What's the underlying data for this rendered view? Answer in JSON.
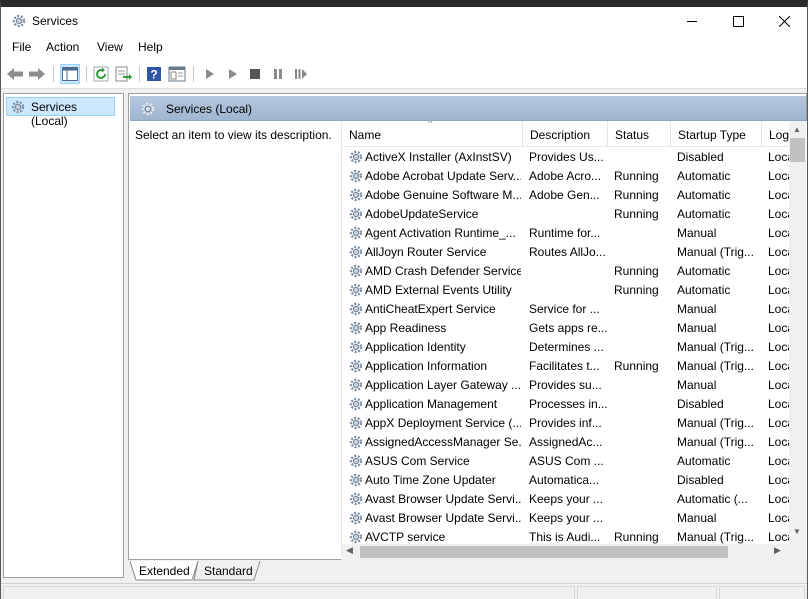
{
  "window": {
    "title": "Services",
    "icon": "gear-icon"
  },
  "menu": [
    "File",
    "Action",
    "View",
    "Help"
  ],
  "toolbar": {
    "buttons": [
      "back-arrow-icon",
      "forward-arrow-icon",
      "show-hide-tree-icon",
      "refresh-icon",
      "export-list-icon",
      "help-icon",
      "properties-icon",
      "start-service-icon",
      "start-service-2-icon",
      "stop-service-icon",
      "pause-service-icon",
      "resume-service-icon"
    ]
  },
  "tree": {
    "selected": "Services (Local)"
  },
  "pane": {
    "header": "Services (Local)",
    "description_hint": "Select an item to view its description."
  },
  "list": {
    "columns": [
      "Name",
      "Description",
      "Status",
      "Startup Type",
      "Log"
    ],
    "rows": [
      {
        "name": "ActiveX Installer (AxInstSV)",
        "desc": "Provides Us...",
        "status": "",
        "startup": "Disabled",
        "logon": "Loca"
      },
      {
        "name": "Adobe Acrobat Update Serv...",
        "desc": "Adobe Acro...",
        "status": "Running",
        "startup": "Automatic",
        "logon": "Loca"
      },
      {
        "name": "Adobe Genuine Software M...",
        "desc": "Adobe Gen...",
        "status": "Running",
        "startup": "Automatic",
        "logon": "Loca"
      },
      {
        "name": "AdobeUpdateService",
        "desc": "",
        "status": "Running",
        "startup": "Automatic",
        "logon": "Loca"
      },
      {
        "name": "Agent Activation Runtime_...",
        "desc": "Runtime for...",
        "status": "",
        "startup": "Manual",
        "logon": "Loca"
      },
      {
        "name": "AllJoyn Router Service",
        "desc": "Routes AllJo...",
        "status": "",
        "startup": "Manual (Trig...",
        "logon": "Loca"
      },
      {
        "name": "AMD Crash Defender Service",
        "desc": "",
        "status": "Running",
        "startup": "Automatic",
        "logon": "Loca"
      },
      {
        "name": "AMD External Events Utility",
        "desc": "",
        "status": "Running",
        "startup": "Automatic",
        "logon": "Loca"
      },
      {
        "name": "AntiCheatExpert Service",
        "desc": "Service for ...",
        "status": "",
        "startup": "Manual",
        "logon": "Loca"
      },
      {
        "name": "App Readiness",
        "desc": "Gets apps re...",
        "status": "",
        "startup": "Manual",
        "logon": "Loca"
      },
      {
        "name": "Application Identity",
        "desc": "Determines ...",
        "status": "",
        "startup": "Manual (Trig...",
        "logon": "Loca"
      },
      {
        "name": "Application Information",
        "desc": "Facilitates t...",
        "status": "Running",
        "startup": "Manual (Trig...",
        "logon": "Loca"
      },
      {
        "name": "Application Layer Gateway ...",
        "desc": "Provides su...",
        "status": "",
        "startup": "Manual",
        "logon": "Loca"
      },
      {
        "name": "Application Management",
        "desc": "Processes in...",
        "status": "",
        "startup": "Disabled",
        "logon": "Loca"
      },
      {
        "name": "AppX Deployment Service (...",
        "desc": "Provides inf...",
        "status": "",
        "startup": "Manual (Trig...",
        "logon": "Loca"
      },
      {
        "name": "AssignedAccessManager Se...",
        "desc": "AssignedAc...",
        "status": "",
        "startup": "Manual (Trig...",
        "logon": "Loca"
      },
      {
        "name": "ASUS Com Service",
        "desc": "ASUS Com ...",
        "status": "",
        "startup": "Automatic",
        "logon": "Loca"
      },
      {
        "name": "Auto Time Zone Updater",
        "desc": "Automatica...",
        "status": "",
        "startup": "Disabled",
        "logon": "Loca"
      },
      {
        "name": "Avast Browser Update Servi...",
        "desc": "Keeps your ...",
        "status": "",
        "startup": "Automatic (...",
        "logon": "Loca"
      },
      {
        "name": "Avast Browser Update Servi...",
        "desc": "Keeps your ...",
        "status": "",
        "startup": "Manual",
        "logon": "Loca"
      },
      {
        "name": "AVCTP service",
        "desc": "This is Audi...",
        "status": "Running",
        "startup": "Manual (Trig...",
        "logon": "Loca"
      }
    ]
  },
  "tabs": [
    "Extended",
    "Standard"
  ]
}
